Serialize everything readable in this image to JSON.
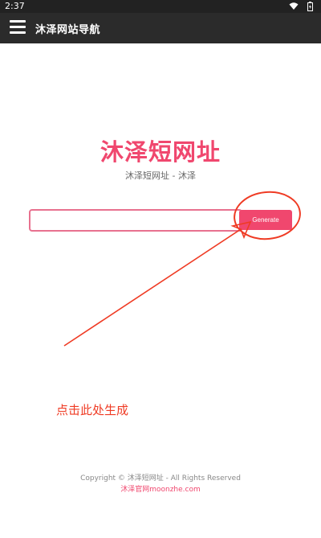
{
  "status_bar": {
    "time": "2:37",
    "icons": [
      "wifi-icon",
      "battery-icon"
    ]
  },
  "app_bar": {
    "menu_icon": "hamburger-menu-icon",
    "title": "沐泽网站导航"
  },
  "main": {
    "title": "沐泽短网址",
    "subtitle": "沐泽短网址 - 沐泽",
    "url_input": {
      "value": "",
      "placeholder": ""
    },
    "generate_label": "Generate"
  },
  "annotation": {
    "text": "点击此处生成",
    "color": "#ef3b24"
  },
  "footer": {
    "copyright": "Copyright © 沐泽短网址 - All Rights Reserved",
    "link_text": "沐泽官网moonzhe.com"
  },
  "colors": {
    "accent": "#f0476e",
    "app_bar": "#2b2b2b",
    "status_bar": "#222222"
  }
}
